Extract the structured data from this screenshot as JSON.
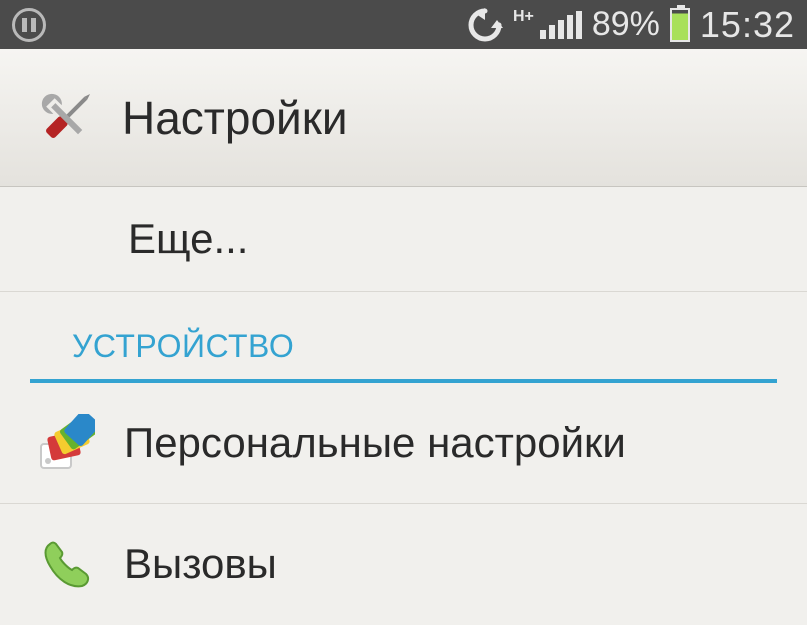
{
  "status": {
    "pause_icon": "pause",
    "sync_icon_name": "sync-icon",
    "network_type": "H+",
    "signal_bars": 5,
    "battery_percent_label": "89%",
    "battery_level": 89,
    "clock": "15:32"
  },
  "header": {
    "title": "Настройки",
    "icon_name": "settings-tools-icon"
  },
  "list": {
    "more_label": "Еще...",
    "section_header": "УСТРОЙСТВО",
    "items": [
      {
        "icon_name": "theme-swatch-icon",
        "label": "Персональные настройки"
      },
      {
        "icon_name": "phone-icon",
        "label": "Вызовы"
      }
    ]
  },
  "colors": {
    "accent": "#34a3d1",
    "status_bg": "#4b4b4b",
    "text": "#2a2a2a",
    "battery_fill": "#a8e05a"
  }
}
